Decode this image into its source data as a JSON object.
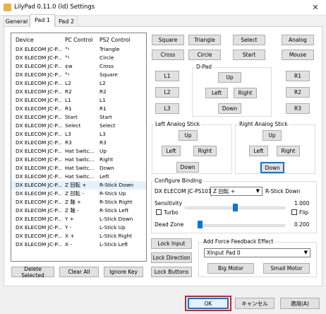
{
  "window": {
    "title": "LilyPad 0.11.0 (ld) Settings",
    "close_glyph": "✕"
  },
  "tabs": [
    {
      "label": "General"
    },
    {
      "label": "Pad 1"
    },
    {
      "label": "Pad 2"
    }
  ],
  "list": {
    "headers": {
      "device": "Device",
      "pc": "PC Control",
      "ps2": "PS2 Control"
    },
    "rows": [
      {
        "device": "DX ELECOM JC-P...",
        "pc": "°ᵡ",
        "ps2": "Triangle"
      },
      {
        "device": "DX ELECOM JC-P...",
        "pc": "°ᵡ",
        "ps2": "Circle"
      },
      {
        "device": "DX ELECOM JC-P...",
        "pc": "¢w",
        "ps2": "Cross"
      },
      {
        "device": "DX ELECOM JC-P...",
        "pc": "°ᵡ",
        "ps2": "Square"
      },
      {
        "device": "DX ELECOM JC-P...",
        "pc": "L2",
        "ps2": "L2"
      },
      {
        "device": "DX ELECOM JC-P...",
        "pc": "R2",
        "ps2": "R2"
      },
      {
        "device": "DX ELECOM JC-P...",
        "pc": "L1",
        "ps2": "L1"
      },
      {
        "device": "DX ELECOM JC-P...",
        "pc": "R1",
        "ps2": "R1"
      },
      {
        "device": "DX ELECOM JC-P...",
        "pc": "Start",
        "ps2": "Start"
      },
      {
        "device": "DX ELECOM JC-P...",
        "pc": "Select",
        "ps2": "Select"
      },
      {
        "device": "DX ELECOM JC-P...",
        "pc": "L3",
        "ps2": "L3"
      },
      {
        "device": "DX ELECOM JC-P...",
        "pc": "R3",
        "ps2": "R3"
      },
      {
        "device": "DX ELECOM JC-P...",
        "pc": "Hat Switc...",
        "ps2": "Up"
      },
      {
        "device": "DX ELECOM JC-P...",
        "pc": "Hat Switc...",
        "ps2": "Right"
      },
      {
        "device": "DX ELECOM JC-P...",
        "pc": "Hat Switc...",
        "ps2": "Down"
      },
      {
        "device": "DX ELECOM JC-P...",
        "pc": "Hat Switc...",
        "ps2": "Left"
      },
      {
        "device": "DX ELECOM JC-P...",
        "pc": "Z 回転 +",
        "ps2": "R-Stick Down"
      },
      {
        "device": "DX ELECOM JC-P...",
        "pc": "Z 回転 -",
        "ps2": "R-Stick Up"
      },
      {
        "device": "DX ELECOM JC-P...",
        "pc": "Z 軸 +",
        "ps2": "R-Stick Right"
      },
      {
        "device": "DX ELECOM JC-P...",
        "pc": "Z 軸 -",
        "ps2": "R-Stick Left"
      },
      {
        "device": "DX ELECOM JC-P...",
        "pc": "Y +",
        "ps2": "L-Stick Down"
      },
      {
        "device": "DX ELECOM JC-P...",
        "pc": "Y -",
        "ps2": "L-Stick Up"
      },
      {
        "device": "DX ELECOM JC-P...",
        "pc": "X +",
        "ps2": "L-Stick Right"
      },
      {
        "device": "DX ELECOM JC-P...",
        "pc": "X -",
        "ps2": "L-Stick Left"
      }
    ]
  },
  "face_buttons": {
    "square": "Square",
    "triangle": "Triangle",
    "select": "Select",
    "analog": "Analog",
    "cross": "Cross",
    "circle": "Circle",
    "start": "Start",
    "mouse": "Mouse"
  },
  "dpad": {
    "label": "D-Pad",
    "up": "Up",
    "left": "Left",
    "right": "Right",
    "down": "Down"
  },
  "shoulders": {
    "l1": "L1",
    "l2": "L2",
    "l3": "L3",
    "r1": "R1",
    "r2": "R2",
    "r3": "R3"
  },
  "left_stick": {
    "label": "Left Analog Stick",
    "up": "Up",
    "left": "Left",
    "right": "Right",
    "down": "Down"
  },
  "right_stick": {
    "label": "Right Analog Stick",
    "up": "Up",
    "left": "Left",
    "right": "Right",
    "down": "Down"
  },
  "configure": {
    "label": "Configure Binding",
    "device": "DX ELECOM JC-PS101U",
    "axis_value": "Z 回転 +",
    "target": "R-Stick Down",
    "sensitivity_label": "Sensitivity",
    "sensitivity_value": "1.000",
    "sensitivity_level": 0.5,
    "turbo_label": "Turbo",
    "flip_label": "Flip",
    "deadzone_label": "Dead Zone",
    "deadzone_value": "0.200",
    "deadzone_level": 0.0
  },
  "lock": {
    "input": "Lock Input",
    "direction": "Lock Direction",
    "buttons": "Lock Buttons"
  },
  "force_feedback": {
    "label": "Add Force Feedback Effect",
    "selected": "XInput Pad 0",
    "big_motor": "Big Motor",
    "small_motor": "Small Motor"
  },
  "bottom_buttons": {
    "delete_selected": "Delete Selected",
    "clear_all": "Clear All",
    "ignore_key": "Ignore Key"
  },
  "dialog": {
    "ok": "OK",
    "cancel": "キャンセル",
    "apply": "適用(A)"
  },
  "colors": {
    "focus": "#0078d7",
    "highlight_outline": "#d81e2a",
    "selected_row": "#e5f1fb"
  }
}
